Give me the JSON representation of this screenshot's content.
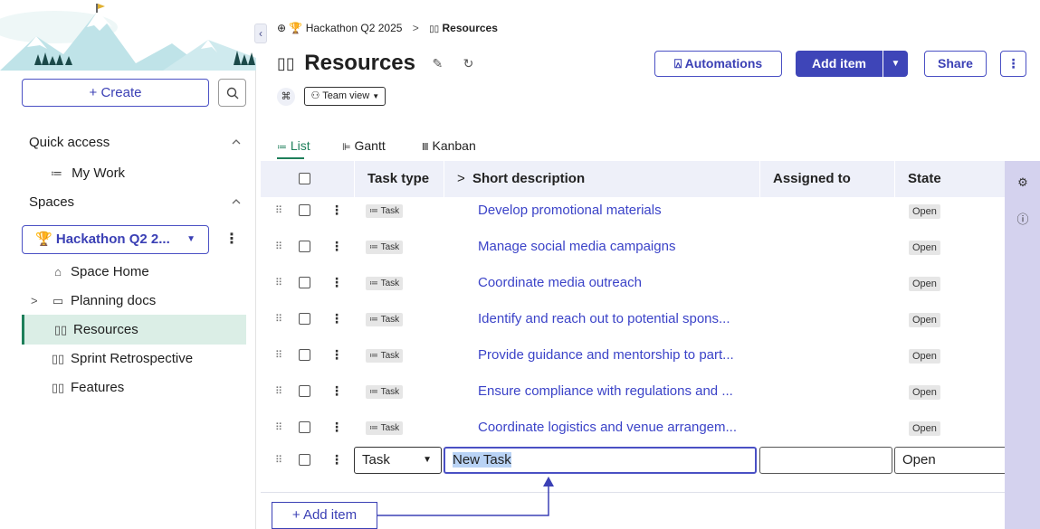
{
  "sidebar": {
    "create_label": "+ Create",
    "quick_access_label": "Quick access",
    "my_work_label": "My Work",
    "spaces_label": "Spaces",
    "space_select_label": "Hackathon Q2 2...",
    "nav_items": [
      {
        "label": "Space Home",
        "icon": "home-icon"
      },
      {
        "label": "Planning docs",
        "icon": "folder-icon"
      },
      {
        "label": "Resources",
        "icon": "board-icon",
        "active": true
      },
      {
        "label": "Sprint Retrospective",
        "icon": "board-icon"
      },
      {
        "label": "Features",
        "icon": "board-icon"
      }
    ]
  },
  "breadcrumb": {
    "space": "Hackathon Q2 2025",
    "page": "Resources"
  },
  "header": {
    "title": "Resources",
    "automations_label": "Automations",
    "add_item_label": "Add item",
    "share_label": "Share"
  },
  "filters": {
    "team_view_label": "Team view"
  },
  "view_tabs": [
    {
      "label": "List",
      "active": true
    },
    {
      "label": "Gantt"
    },
    {
      "label": "Kanban"
    }
  ],
  "table": {
    "columns": {
      "task_type": "Task type",
      "short_description": "Short description",
      "assigned_to": "Assigned to",
      "state": "State"
    },
    "rows": [
      {
        "type": "Task",
        "description": "Develop promotional materials",
        "state": "Open"
      },
      {
        "type": "Task",
        "description": "Manage social media campaigns",
        "state": "Open"
      },
      {
        "type": "Task",
        "description": "Coordinate media outreach",
        "state": "Open"
      },
      {
        "type": "Task",
        "description": "Identify and reach out to potential spons...",
        "state": "Open"
      },
      {
        "type": "Task",
        "description": "Provide guidance and mentorship to part...",
        "state": "Open"
      },
      {
        "type": "Task",
        "description": "Ensure compliance with regulations and ...",
        "state": "Open"
      },
      {
        "type": "Task",
        "description": "Coordinate logistics and venue arrangem...",
        "state": "Open"
      }
    ],
    "new_row": {
      "type_value": "Task",
      "description_value": "New Task",
      "state_value": "Open"
    },
    "add_item_label": "+ Add item"
  },
  "colors": {
    "accent": "#3e45b8",
    "active_green": "#1e7f5a",
    "rail": "#d4d2ee",
    "header_bg": "#eef0f9"
  }
}
